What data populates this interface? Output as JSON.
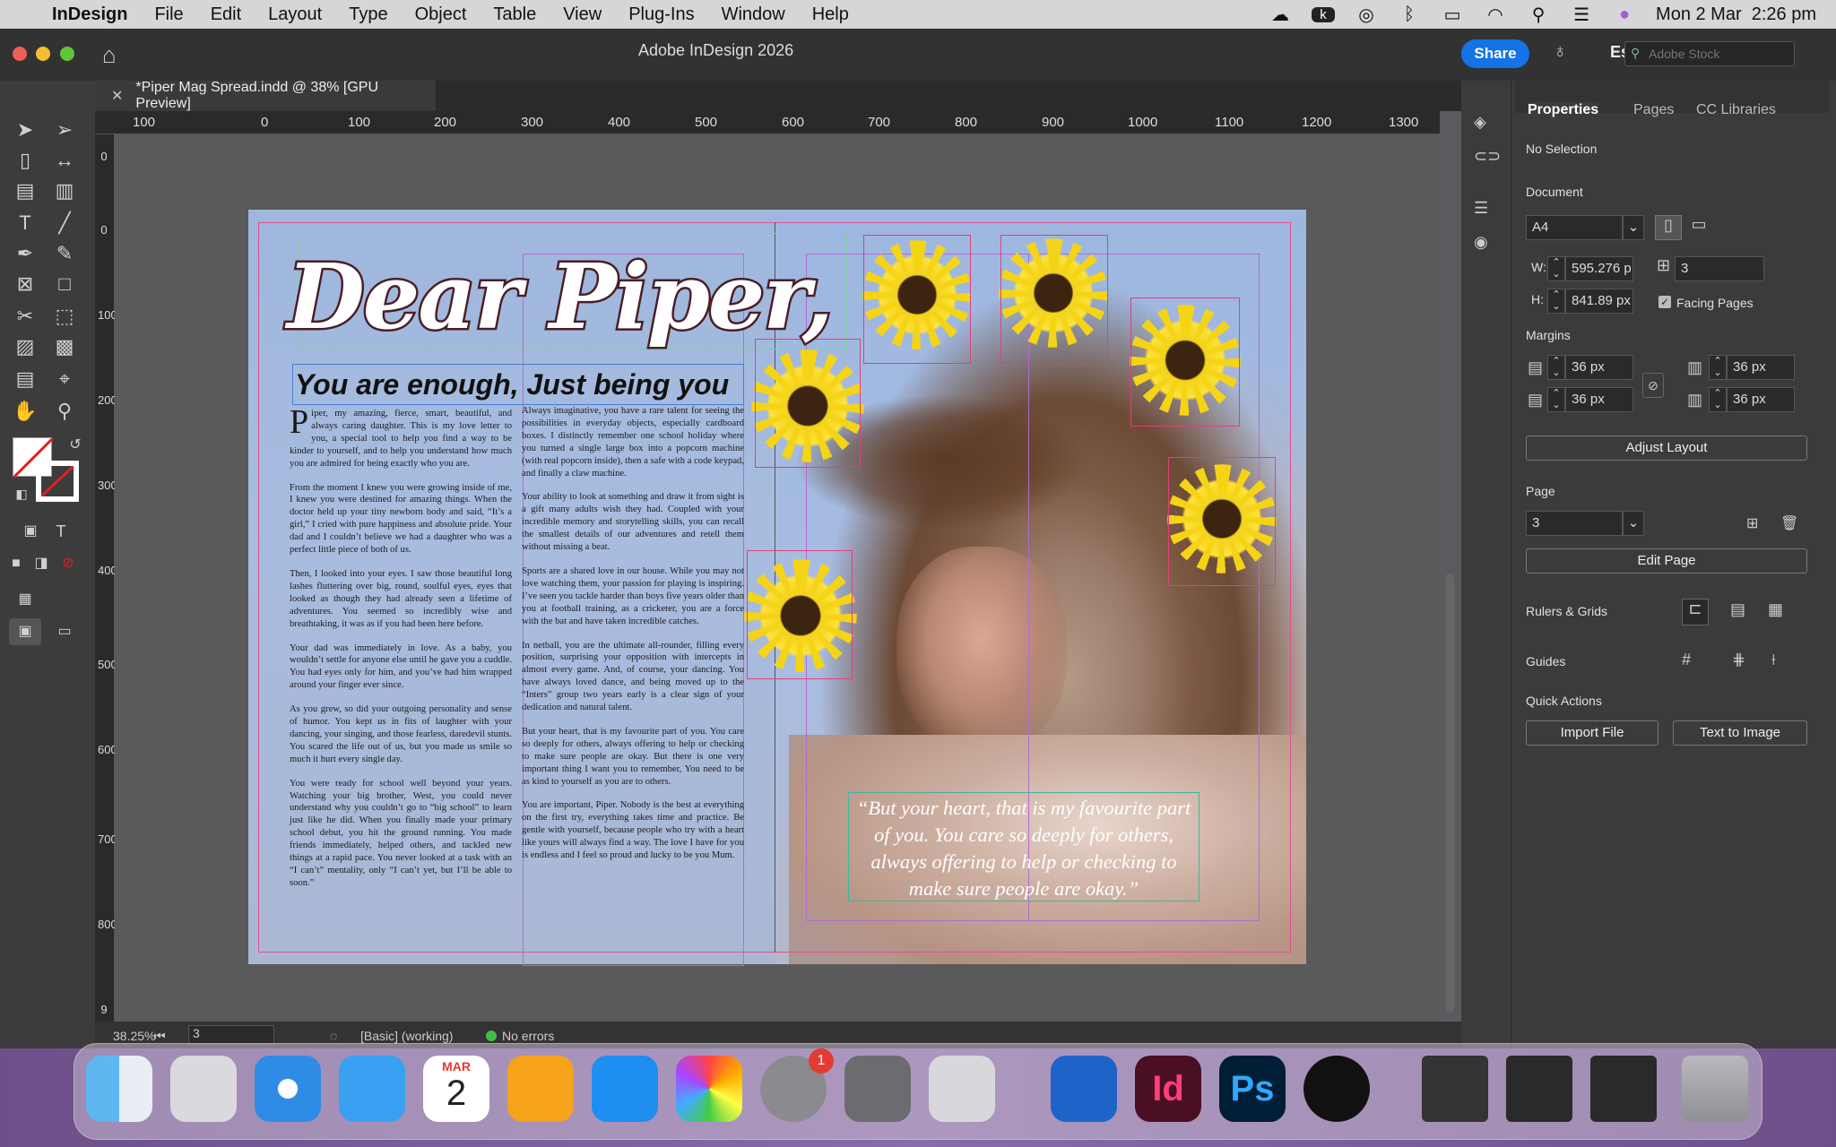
{
  "menubar": {
    "app": "InDesign",
    "items": [
      "File",
      "Edit",
      "Layout",
      "Type",
      "Object",
      "Table",
      "View",
      "Plug-Ins",
      "Window",
      "Help"
    ],
    "clock": "Mon 2 Mar  2:26 pm"
  },
  "titlebar": {
    "title": "Adobe InDesign 2026",
    "share": "Share",
    "workspace": "Essentials",
    "stock_placeholder": "Adobe Stock"
  },
  "doc_tab": {
    "label": "*Piper Mag Spread.indd @ 38% [GPU Preview]"
  },
  "ruler": {
    "h_labels": [
      "100",
      "0",
      "100",
      "200",
      "300",
      "400",
      "500",
      "600",
      "700",
      "800",
      "900",
      "1000",
      "1100",
      "1200",
      "1300"
    ],
    "v_labels": [
      "0",
      "0",
      "100",
      "200",
      "300",
      "400",
      "500",
      "600",
      "700",
      "800",
      "9"
    ]
  },
  "spread": {
    "headline": "Dear Piper,",
    "subhead": "You are enough, Just being you",
    "col1": [
      "Piper, my amazing, fierce, smart, beautiful, and always caring daughter. This is my love letter to you, a special tool to help you find a way to be kinder to yourself, and to help you understand how much you are admired for being exactly who you are.",
      "From the moment I knew you were growing inside of me, I knew you were destined for amazing things. When the doctor held up your tiny newborn body and said, “It’s a girl,” I cried with pure happiness and absolute pride. Your dad and I couldn’t believe we had a daughter who was a perfect little piece of both of us.",
      "Then, I looked into your eyes. I saw those beautiful long lashes fluttering over big, round, soulful eyes, eyes that looked as though they had already seen a lifetime of adventures. You seemed so incredibly wise and breathtaking, it was as if you had been here before.",
      "Your dad was immediately in love. As a baby, you wouldn’t settle for anyone else until he gave you a cuddle. You had eyes only for him, and you’ve had him wrapped around your finger ever since.",
      "As you grew, so did your outgoing personality and sense of humor. You kept us in fits of laughter with your dancing, your singing, and those fearless, daredevil stunts. You scared the life out of us, but you made us smile so much it hurt every single day.",
      "You were ready for school well beyond your years. Watching your big brother, West, you could never understand why you couldn’t go to “big school” to learn just like he did. When you finally made your primary school debut, you hit the ground running. You made friends immediately, helped others, and tackled new things at a rapid pace. You never looked at a task with an “I can’t” mentality, only “I can’t yet, but I’ll be able to soon.”"
    ],
    "col2": [
      "Always imaginative, you have a rare talent for seeing the possibilities in everyday objects, especially cardboard boxes. I distinctly remember one school holiday where you turned a single large box into a popcorn machine (with real popcorn inside), then a safe with a code keypad, and finally a claw machine.",
      "Your ability to look at something and draw it from sight is a gift many adults wish they had. Coupled with your incredible memory and storytelling skills, you can recall the smallest details of our adventures and retell them without missing a beat.",
      "Sports are a shared love in our house. While you may not love watching them, your passion for playing is inspiring. I’ve seen you tackle harder than boys five years older than you at football training, as a cricketer, you are a force with the bat and have taken incredible catches.",
      "In netball, you are the ultimate all-rounder, filling every position, surprising your opposition with intercepts in almost every game. And, of course, your dancing. You have always loved dance, and being moved up to the “Inters” group two years early is a clear sign of your dedication and natural talent.",
      "But your heart, that is my favourite part of you. You care so deeply for others, always offering to help or checking to make sure people are okay. But there is one very important thing I want you to remember, You need to be as kind to yourself as you are to others.",
      "You are important, Piper. Nobody is the best at everything on the first try, everything takes time and practice. Be gentle with yourself, because people who try with a heart like yours will always find a way. The love I have for you is endless and I feel so proud and lucky to be you Mum."
    ],
    "quote": "“But your heart, that is my favourite part of you. You care so deeply for others, always offering to help or checking to make sure people are okay.”"
  },
  "panel": {
    "tabs": [
      "Properties",
      "Pages",
      "CC Libraries"
    ],
    "selection": "No Selection",
    "document": "Document",
    "preset": "A4",
    "w_label": "W:",
    "w": "595.276 p",
    "h_label": "H:",
    "h": "841.89 px",
    "pages_count": "3",
    "facing": "Facing Pages",
    "margins": "Margins",
    "m_top": "36 px",
    "m_bottom": "36 px",
    "m_left": "36 px",
    "m_right": "36 px",
    "adjust": "Adjust Layout",
    "page": "Page",
    "page_num": "3",
    "edit_page": "Edit Page",
    "rulers": "Rulers & Grids",
    "guides": "Guides",
    "quick": "Quick Actions",
    "import": "Import File",
    "text_to_image": "Text to Image"
  },
  "status": {
    "zoom": "38.25%",
    "page": "3",
    "style": "[Basic] (working)",
    "errors": "No errors"
  },
  "dock": {
    "calendar_month": "MAR",
    "calendar_day": "2",
    "badge": "1"
  }
}
